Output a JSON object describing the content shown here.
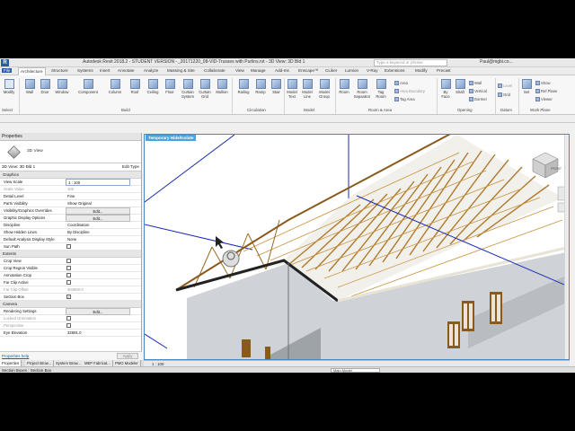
{
  "app": {
    "title": "Autodesk Revit 2018.2 - STUDENT VERSION -",
    "file": "_20171220_08-VID-Trusses with Purlins.rvt - 3D View: 3D Bld 1",
    "logo": "R",
    "search_placeholder": "Type a keyword or phrase",
    "user": "Paul@mgbi.co..."
  },
  "tabs": [
    "File",
    "Architecture",
    "Structure",
    "Systems",
    "Insert",
    "Annotate",
    "Analyze",
    "Massing & Site",
    "Collaborate",
    "View",
    "Manage",
    "Add-Ins",
    "Enscape™",
    "CLiker",
    "Lumion",
    "V-Ray",
    "Extensions",
    "Modify",
    "Precast"
  ],
  "ribbon": {
    "modify": "Modify",
    "build": [
      "Wall",
      "Door",
      "Window",
      "Component",
      "Column",
      "Roof",
      "Ceiling",
      "Floor",
      "Curtain System",
      "Curtain Grid",
      "Mullion"
    ],
    "circulation": [
      "Railing",
      "Ramp",
      "Stair"
    ],
    "model": [
      "Model Text",
      "Model Line",
      "Model Group"
    ],
    "room": [
      "Room",
      "Room Separator",
      "Tag Room",
      "Area",
      "Area Boundary",
      "Tag Area"
    ],
    "opening": [
      "By Face",
      "Shaft",
      "Wall",
      "Vertical",
      "Dormer"
    ],
    "datum": [
      "Level",
      "Grid"
    ],
    "workplane": [
      "Set",
      "Show",
      "Ref Plane",
      "Viewer"
    ],
    "groups": {
      "select": "Select",
      "build": "Build",
      "circulation": "Circulation",
      "model": "Model",
      "room": "Room & Area",
      "opening": "Opening",
      "datum": "Datum",
      "workplane": "Work Plane"
    }
  },
  "properties": {
    "header": "Properties",
    "type": "3D View",
    "view_selector": "3D View: 3D Bld 1",
    "edit_type": "Edit Type",
    "graphics_group": "Graphics",
    "extents_group": "Extents",
    "camera_group": "Camera",
    "rows": {
      "view_scale": [
        "View Scale",
        "1 : 100"
      ],
      "scale_value": [
        "Scale Value",
        "100"
      ],
      "detail_level": [
        "Detail Level",
        "Fine"
      ],
      "parts_vis": [
        "Parts Visibility",
        "Show Original"
      ],
      "vg": [
        "Visibility/Graphics Overrides",
        "Edit..."
      ],
      "gdo": [
        "Graphic Display Options",
        "Edit..."
      ],
      "discipline": [
        "Discipline",
        "Coordination"
      ],
      "hidden": [
        "Show Hidden Lines",
        "By Discipline"
      ],
      "dads": [
        "Default Analysis Display Style",
        "None"
      ],
      "sunpath": [
        "Sun Path",
        ""
      ],
      "cropview": [
        "Crop View",
        ""
      ],
      "cropregion": [
        "Crop Region Visible",
        ""
      ],
      "anncrop": [
        "Annotation Crop",
        ""
      ],
      "farclip": [
        "Far Clip Active",
        ""
      ],
      "faroffset": [
        "Far Clip Offset",
        "304800.0"
      ],
      "sectionbox": [
        "Section Box",
        ""
      ],
      "render": [
        "Rendering Settings",
        "Edit..."
      ],
      "locked": [
        "Locked Orientation",
        ""
      ],
      "persp": [
        "Perspective",
        ""
      ],
      "eye": [
        "Eye Elevation",
        "32691.0"
      ]
    },
    "help": "Properties help",
    "apply": "Apply"
  },
  "bottom_tabs": [
    "Properties",
    "Project Brow...",
    "System Brow...",
    "MEP Fabricat...",
    "PMO Modeler"
  ],
  "viewport": {
    "banner": "Temporary Hide/Isolate",
    "scale": "1 : 100",
    "viewcube": "FRONT"
  },
  "status": {
    "text": "Section Boxes : Section Box",
    "model": "Main Model"
  }
}
